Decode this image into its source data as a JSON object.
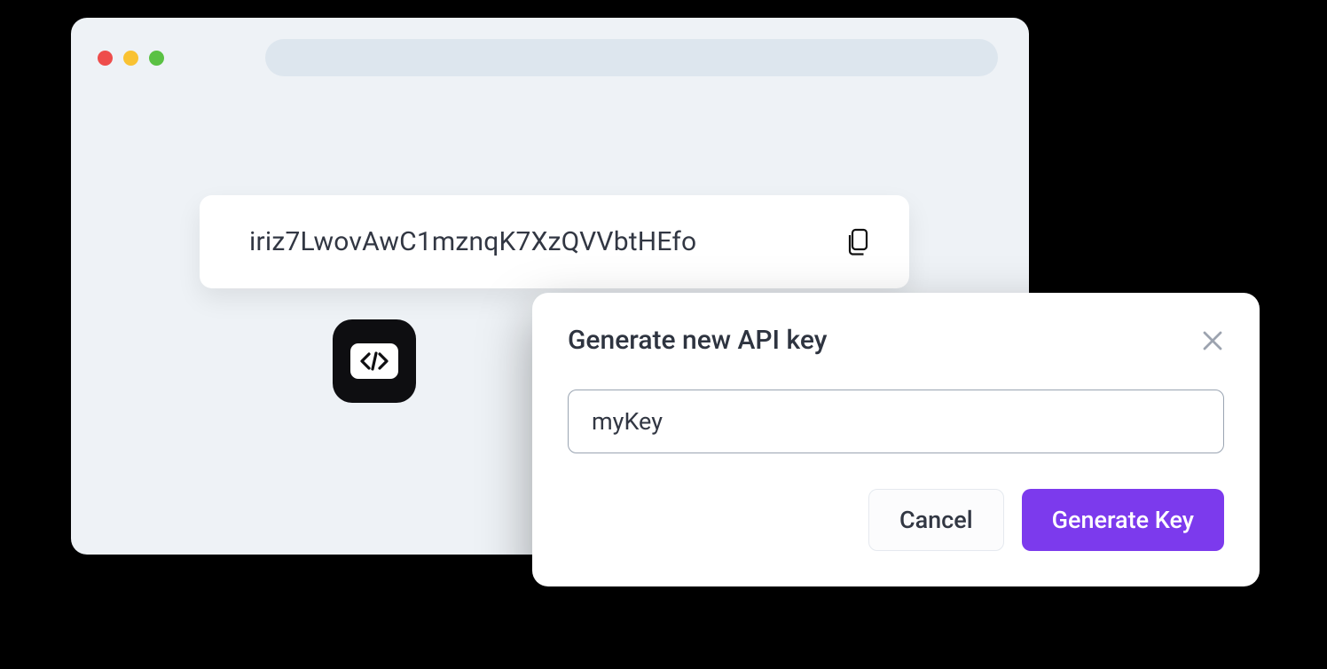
{
  "api_key_display": {
    "value": "iriz7LwovAwC1mznqK7XzQVVbtHEfo"
  },
  "modal": {
    "title": "Generate new API key",
    "input_value": "myKey",
    "cancel_label": "Cancel",
    "generate_label": "Generate Key"
  },
  "colors": {
    "primary": "#7c3aed",
    "window_bg": "#eef2f6",
    "url_bar_bg": "#dde6ee"
  }
}
